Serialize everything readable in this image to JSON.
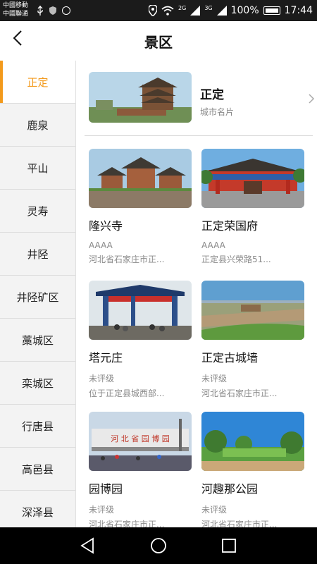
{
  "status_bar": {
    "carrier1": "中國移動",
    "carrier2": "中國聯通",
    "net1": "2G",
    "net2": "3G",
    "battery": "100%",
    "time": "17:44"
  },
  "header": {
    "title": "景区"
  },
  "sidebar": {
    "items": [
      {
        "label": "正定"
      },
      {
        "label": "鹿泉"
      },
      {
        "label": "平山"
      },
      {
        "label": "灵寿"
      },
      {
        "label": "井陉"
      },
      {
        "label": "井陉矿区"
      },
      {
        "label": "藁城区"
      },
      {
        "label": "栾城区"
      },
      {
        "label": "行唐县"
      },
      {
        "label": "高邑县"
      },
      {
        "label": "深泽县"
      }
    ]
  },
  "city_card": {
    "name": "正定",
    "subtitle": "城市名片"
  },
  "spots": [
    {
      "name": "隆兴寺",
      "level": "AAAA",
      "address": "河北省石家庄市正..."
    },
    {
      "name": "正定荣国府",
      "level": "AAAA",
      "address": "正定县兴荣路51..."
    },
    {
      "name": "塔元庄",
      "level": "未评级",
      "address": "位于正定县城西部..."
    },
    {
      "name": "正定古城墙",
      "level": "未评级",
      "address": "河北省石家庄市正..."
    },
    {
      "name": "园博园",
      "level": "未评级",
      "address": "河北省石家庄市正...",
      "sign": "河 北 省 园 博 园"
    },
    {
      "name": "河趣那公园",
      "level": "未评级",
      "address": "河北省石家庄市正..."
    }
  ],
  "colors": {
    "accent": "#f39a1c"
  }
}
